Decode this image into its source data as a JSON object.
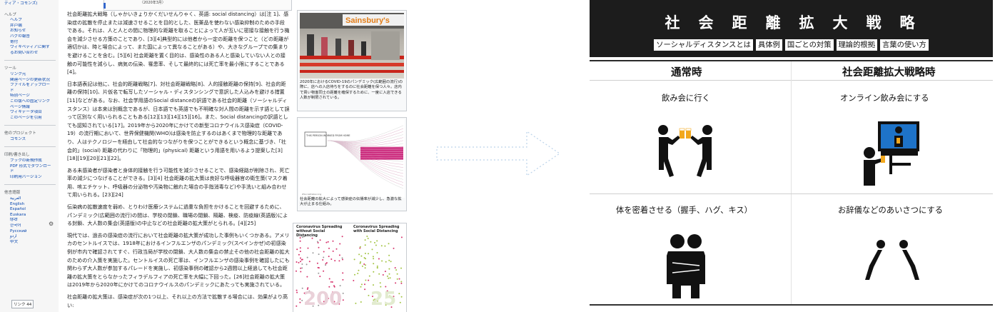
{
  "wiki": {
    "topbar_caption": "（2020年3月）",
    "sidebar": {
      "top_link": "ティア・コモンズ)",
      "help_heading": "ヘルプ",
      "help_items": [
        "ヘルプ",
        "井戸端",
        "お知らせ",
        "バグの報告",
        "寄付",
        "ウィキペディアに関す",
        "るお問い合わせ"
      ],
      "tools_heading": "ツール",
      "tools_items": [
        "リンク元",
        "関連ページの更新状況",
        "ファイルをアップロー",
        "ド",
        "特別ページ",
        "この版への固定リンク",
        "ページ情報",
        "ウィキデータ項目",
        "このページを引用"
      ],
      "other_heading": "他のプロジェクト",
      "other_items": [
        "コモンズ"
      ],
      "print_heading": "印刷/書き出し",
      "print_items": [
        "ブックの新規作成",
        "PDF 形式でダウンロー",
        "ド",
        "印刷用バージョン"
      ],
      "lang_heading": "他言語版",
      "lang_items": [
        "العربية",
        "English",
        "Español",
        "Euskara",
        "हिन्दी",
        "한국어",
        "Русский",
        "اردو",
        "中文"
      ],
      "lang_button": "リンク 44"
    },
    "paragraphs": {
      "p1": "社会距離拡大戦略（しゃかいきょりかくだいせんりゃく、英語: social distancing）は[注 1]、感染症の拡散を停止または減速させることを目的とした、医薬品を使わない感染抑制のための手段である。それは、人と人との間に物理的な距離を取ることによって人が互いに密接な接触を行う機会を減少させる方策のことであり、[3][4]典型的には他者から一定の距離を保つこと（どの距離が適切かは、時と場合によって、また国によって異なることがある）や、大きなグループでの集まりを避けることを含む。[5][6] 社会距離を置く目的は、感染性のある人と感染していない人との接触の可能性を減らし、病気の伝染、罹患率、そして最終的には死亡率を最小限にすることである[4]。",
      "p2": "日本語表記は他に、社会的距離戦略[7]、対社会距離戦略[8]、人的接触距離の保持[9]、社会的距離の保持[10]、片仮名で転写したソーシャル・ディスタンシングで意訳した人込みを避ける措置[11]などがある。なお、社会学用語のSocial distanceの訳語である社会的距離（ソーシャルディスタンス）は本来は別概念であるが、日本語でも英語でも不明確な対人間の距離を示す語として誤って区別なく用いられることもある[12][13][14][15][16]。また、Social distancingの訳語としても認知されている[17]。2019年から2020年にかけての新型コロナウイルス感染症（COVID-19）の流行期において、世界保健機関(WHO)は感染を防止するのはあくまで物理的な距離であり、人はテクノロジーを経由して社会的なつながりを保つことができるという概念に基づき、「社会的」(social) 距離の代わりに「物理的」(physical) 距離という用語を用いるよう提案した[3][18][19][20][21][22]。",
      "p3": "ある未感染者が感染者と身体的接触を行う可能性を減少させることで、感染経路が削除され、死亡率の減少につなげることができる。[3][4] 社会距離の拡大策は良好な呼吸器官の衛生策(マスク着用、咳エチケット、呼吸器の分泌物や汚染物に触れた場合の手指消毒など)や手洗いと組み合わせて用いられる。[23][24]",
      "p4": "伝染病の拡散速度を弱め、とりわけ医療システムに過重な負担をかけることを回避するために、パンデミック(広範囲の流行)の間は、学校の閉鎖、職場の閉鎖、隔離、検疫、防疫線(英語版)による封鎖、大人数の集会(英語版)の中止などの社会距離の拡大策がとられる。[4][25]",
      "p5": "現代では、過去の感染症の流行において社会距離の拡大策が成功した事例もいくつかある。アメリカのセントルイスでは、1918年におけるインフルエンザのパンデミック(スペインかぜ)の初感染例が市内で確認されてすぐ、行政当局が学校の閉鎖、大人数の集会の禁止その他の社会距離の拡大のための介入策を実施した。セントルイスの死亡率は、インフルエンザの感染事例を確認したにも関わらず大人数が参加するパレードを実施し、初感染事例の確認から2週間以上経過しても社会距離の拡大策をとらなかったフィラデルフィアの死亡率を大幅に下回った。[26]社会距離の拡大策は2019年から2020年にかけてのコロナウイルスのパンデミックにあたっても実施されている。",
      "p6": "社会距離の拡大策は、感染症が次の1つ以上、それ以上の方法で拡散する場合には、効果がより高い:"
    },
    "thumb1_caption": "2020年におけるCOVID-19のパンデミック(広範囲の流行)の際に、店への入店待ちをするのに社会距離を保つ人々。店内で買い物客同士の距離を確保するために、一度に入店できる人数が制限されている。",
    "thumb1_sign": "Sainsbury's",
    "thumb2_caption": "社会距離の拡大によって感染症の伝播率が減少し、急激な拡大が止まる仕組み。",
    "thumb2_box": "THIS PERSON WORKED FROM HOME",
    "thumb2_credit": "#SocialDistancing",
    "thumb3_left_title": "Coronavirus Spreading without Social Distancing",
    "thumb3_right_title": "Coronavirus Spreading with Social Distancing",
    "thumb3_left_number": "200",
    "thumb3_right_number": "25"
  },
  "poster": {
    "title": "社会距離拡大戦略",
    "tabs": [
      "ソーシャルディスタンスとは",
      "具体例",
      "国ごとの対策",
      "理論的根拠",
      "言葉の使い方"
    ],
    "col_left": "通常時",
    "col_right": "社会距離拡大戦略時",
    "rows": [
      {
        "left": "飲み会に行く",
        "right": "オンライン飲み会にする"
      },
      {
        "left": "体を密着させる（握手、ハグ、キス）",
        "right": "お辞儀などのあいさつにする"
      }
    ]
  },
  "colors": {
    "poster_band": "#1c1c1c",
    "link": "#0645ad",
    "beer": "#f2a81d",
    "screen": "#1e73c8"
  }
}
